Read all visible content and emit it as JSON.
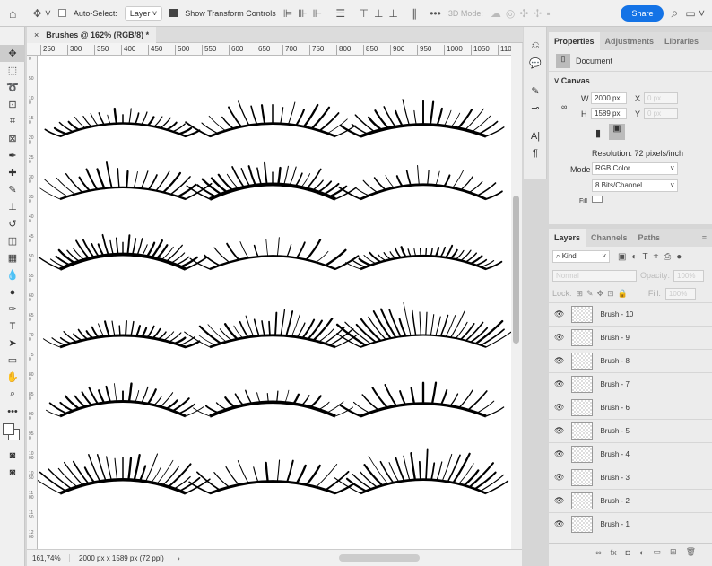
{
  "options_bar": {
    "auto_select_label": "Auto-Select:",
    "auto_select_value": "Layer",
    "show_transform_label": "Show Transform Controls",
    "mode_3d_label": "3D Mode:",
    "share_label": "Share"
  },
  "document_tab": {
    "title": "Brushes @ 162% (RGB/8) *"
  },
  "ruler": {
    "h_ticks": [
      "250",
      "300",
      "350",
      "400",
      "450",
      "500",
      "550",
      "600",
      "650",
      "700",
      "750",
      "800",
      "850",
      "900",
      "950",
      "1000",
      "1050",
      "1100"
    ],
    "v_ticks": [
      "0",
      "50",
      "100",
      "150",
      "200",
      "250",
      "300",
      "350",
      "400",
      "450",
      "500",
      "550",
      "600",
      "650",
      "700",
      "750",
      "800",
      "850",
      "900",
      "950",
      "1000",
      "1050",
      "1100",
      "1150",
      "1200"
    ]
  },
  "status": {
    "zoom": "161,74%",
    "doc_info": "2000 px x 1589 px (72 ppi)",
    "arrow": "›"
  },
  "properties": {
    "tabs": [
      "Properties",
      "Adjustments",
      "Libraries"
    ],
    "doc_label": "Document",
    "section": "Canvas",
    "w_label": "W",
    "w_value": "2000 px",
    "h_label": "H",
    "h_value": "1589 px",
    "x_label": "X",
    "x_value": "0 px",
    "y_label": "Y",
    "y_value": "0 px",
    "resolution": "Resolution: 72 pixels/inch",
    "mode_label": "Mode",
    "mode_value": "RGB Color",
    "bits_value": "8 Bits/Channel",
    "fill_label": "Fill"
  },
  "layers": {
    "tabs": [
      "Layers",
      "Channels",
      "Paths"
    ],
    "kind": "Kind",
    "blend": "Normal",
    "opacity_label": "Opacity:",
    "opacity_value": "100%",
    "lock_label": "Lock:",
    "fill_label": "Fill:",
    "fill_value": "100%",
    "items": [
      "Brush - 10",
      "Brush - 9",
      "Brush - 8",
      "Brush - 7",
      "Brush - 6",
      "Brush - 5",
      "Brush - 4",
      "Brush - 3",
      "Brush - 2",
      "Brush - 1"
    ]
  },
  "colors": {
    "accent": "#1473e6"
  }
}
